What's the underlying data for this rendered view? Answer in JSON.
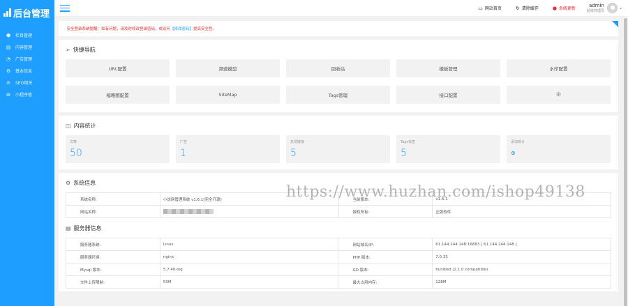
{
  "sidebar": {
    "logo_text": "后台管理",
    "items": [
      {
        "icon": "cube-icon",
        "glyph": "⬢",
        "label": "栏目管理"
      },
      {
        "icon": "document-icon",
        "glyph": "▤",
        "label": "内容管理"
      },
      {
        "icon": "megaphone-icon",
        "glyph": "◔",
        "label": "广告管理"
      },
      {
        "icon": "settings-icon",
        "glyph": "⚙",
        "label": "基本信息"
      },
      {
        "icon": "seo-icon",
        "glyph": "⊘",
        "label": "SEO相关"
      },
      {
        "icon": "apps-icon",
        "glyph": "⊞",
        "label": "小程序管"
      }
    ]
  },
  "topbar": {
    "links": [
      {
        "icon": "monitor-icon",
        "glyph": "▭",
        "label": "网站首页"
      },
      {
        "icon": "refresh-icon",
        "glyph": "↻",
        "label": "清除缓存"
      },
      {
        "icon": "alert-icon",
        "glyph": "●",
        "label": "系统更新"
      }
    ],
    "user_name": "admin",
    "user_role": "超级管理员"
  },
  "notice": {
    "text": "· 安全登录系统提醒：如有问题，请及时修改登录密码，或访问 ",
    "link": "【修改密码】",
    "tail": "提高安全性。"
  },
  "quick_nav": {
    "title": "快捷导航",
    "items": [
      "URL配置",
      "频道模型",
      "回收站",
      "模板管理",
      "水印配置",
      "缩略图配置",
      "SiteMap",
      "Tags管理",
      "接口配置"
    ]
  },
  "stats": {
    "title": "内容统计",
    "items": [
      {
        "label": "文章",
        "value": "50"
      },
      {
        "label": "广告",
        "value": "1"
      },
      {
        "label": "友情链接",
        "value": "5"
      },
      {
        "label": "Tags标签",
        "value": "5"
      },
      {
        "label": "添加统计",
        "value": "⊕"
      }
    ]
  },
  "system": {
    "title": "系统信息",
    "rows": [
      {
        "k1": "系统名称:",
        "v1": "小说网管理系统 v1.6.1[完全开源]",
        "k2": "当前版本:",
        "v2": "v1.6.1"
      },
      {
        "k1": "网站名称:",
        "v1": "",
        "k2": "授权所有:",
        "v2": "正版软件"
      }
    ]
  },
  "server": {
    "title": "服务器信息",
    "rows": [
      {
        "k1": "服务器系统:",
        "v1": "Linux",
        "k2": "网站域名/IP:",
        "v2": "61.144.244.148:16883 [ 61.144.244.148 ]"
      },
      {
        "k1": "服务器环境:",
        "v1": "nginx",
        "k2": "PHP 版本:",
        "v2": "7.0.33"
      },
      {
        "k1": "Mysql 版本:",
        "v1": "5.7.40-log",
        "k2": "GD 版本:",
        "v2": "bundled (2.1.0 compatible)"
      },
      {
        "k1": "文件上传限制:",
        "v1": "50M",
        "k2": "最大占用内存:",
        "v2": "128M"
      }
    ]
  },
  "watermark": "https://www.huzhan.com/ishop49138"
}
